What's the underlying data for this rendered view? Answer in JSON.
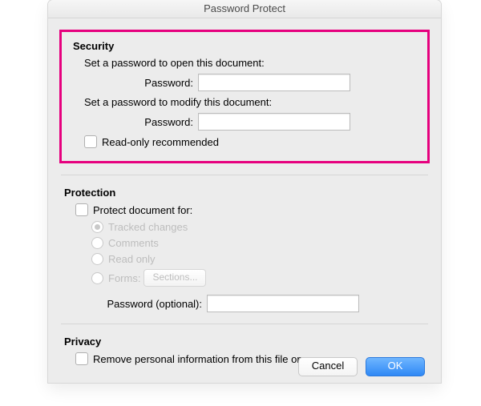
{
  "window": {
    "title": "Password Protect"
  },
  "security": {
    "heading": "Security",
    "open_label": "Set a password to open this document:",
    "password_label": "Password:",
    "modify_label": "Set a password to modify this document:",
    "readonly_label": "Read-only recommended"
  },
  "protection": {
    "heading": "Protection",
    "protect_for_label": "Protect document for:",
    "radios": {
      "tracked": "Tracked changes",
      "comments": "Comments",
      "readonly": "Read only",
      "forms": "Forms:"
    },
    "sections_btn": "Sections...",
    "password_optional_label": "Password (optional):"
  },
  "privacy": {
    "heading": "Privacy",
    "remove_label": "Remove personal information from this file on save"
  },
  "buttons": {
    "cancel": "Cancel",
    "ok": "OK"
  }
}
